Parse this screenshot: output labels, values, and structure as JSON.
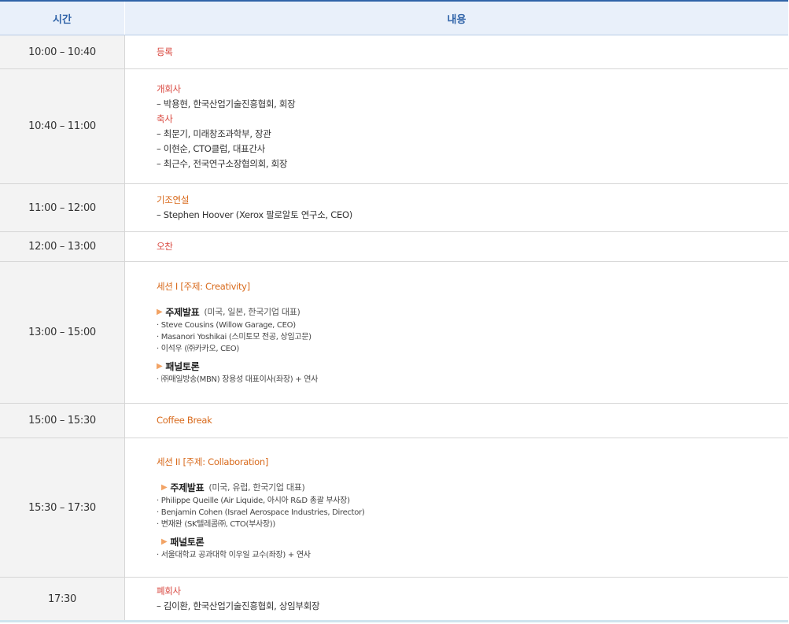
{
  "header": {
    "time": "시간",
    "content": "내용"
  },
  "rows": [
    {
      "time": "10:00 – 10:40",
      "title": "등록"
    },
    {
      "time": "10:40 – 11:00",
      "lines": [
        "개회사",
        "– 박용현, 한국산업기술진흥협회, 회장",
        "축사",
        "– 최문기, 미래창조과학부, 장관",
        "– 이현순, CTO클럽, 대표간사",
        "– 최근수, 전국연구소장협의회, 회장"
      ]
    },
    {
      "time": "11:00 – 12:00",
      "title": "기조연설",
      "lines": [
        "– Stephen Hoover (Xerox 팔로알토 연구소, CEO)"
      ]
    },
    {
      "time": "12:00 – 13:00",
      "title": "오찬"
    },
    {
      "time": "13:00 – 15:00",
      "session": "세션 I [주제: Creativity]",
      "keynote": {
        "label": "주제발표",
        "desc": "(미국, 일본, 한국기업 대표)"
      },
      "speakers": [
        "· Steve Cousins (Willow Garage, CEO)",
        "· Masanori Yoshikai (스미토모 전공, 상임고문)",
        "· 이석우 (㈜카카오, CEO)"
      ],
      "panel": {
        "label": "패널토론"
      },
      "panel_items": [
        "· ㈜매일방송(MBN) 장용성 대표이사(좌장) + 연사"
      ]
    },
    {
      "time": "15:00 – 15:30",
      "title": "Coffee Break"
    },
    {
      "time": "15:30 – 17:30",
      "session": "세션 II [주제: Collaboration]",
      "keynote": {
        "label": "주제발표",
        "desc": "(미국, 유럽, 한국기업 대표)"
      },
      "speakers": [
        "· Philippe Queille (Air Liquide, 아시아 R&D 총괄 부사장)",
        "· Benjamin Cohen (Israel Aerospace Industries, Director)",
        "· 변재완 (SK텔레콤㈜, CTO(부사장))"
      ],
      "panel": {
        "label": "패널토론"
      },
      "panel_items": [
        "· 서울대학교 공과대학 이우일 교수(좌장) + 연사"
      ]
    },
    {
      "time": "17:30",
      "title": "폐회사",
      "lines": [
        "– 김이환, 한국산업기술진흥협회, 상임부회장"
      ]
    }
  ],
  "icons": {
    "bullet": "triangle-right-icon"
  },
  "colors": {
    "header_text": "#2f63a8",
    "header_bg": "#e9f0fa",
    "title_orange": "#d86a1c",
    "title_red": "#d9473f"
  }
}
